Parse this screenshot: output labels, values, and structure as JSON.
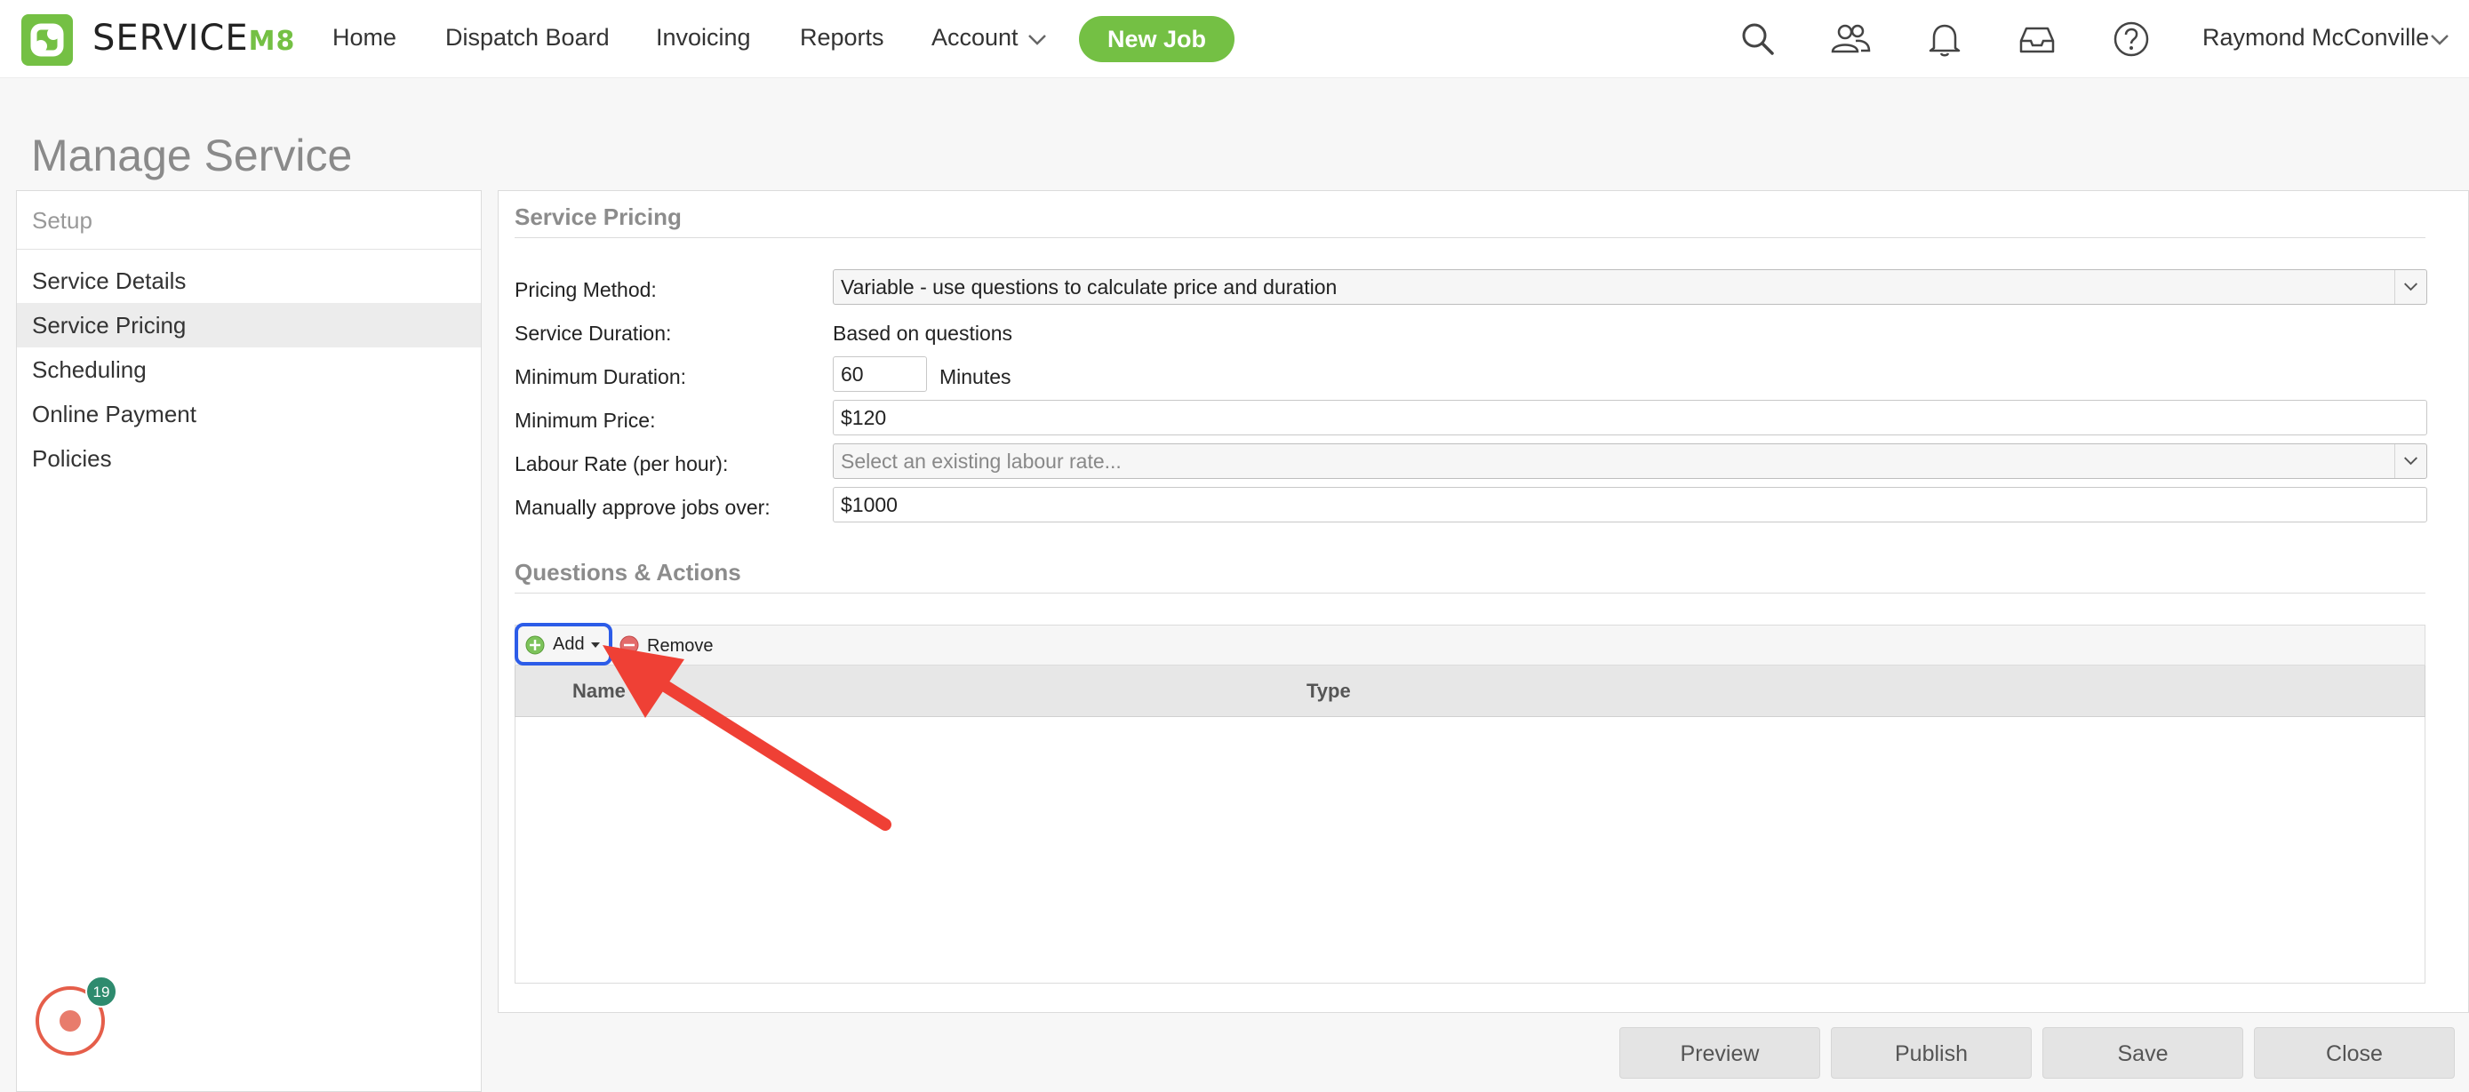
{
  "brand": {
    "name": "SERVICE",
    "suffix": "M8",
    "accent": "#74c044"
  },
  "nav": {
    "home": "Home",
    "dispatch": "Dispatch Board",
    "invoicing": "Invoicing",
    "reports": "Reports",
    "account": "Account",
    "new_job": "New Job",
    "user": "Raymond McConville"
  },
  "page": {
    "title": "Manage Service"
  },
  "sidebar": {
    "heading": "Setup",
    "items": [
      {
        "label": "Service Details"
      },
      {
        "label": "Service Pricing",
        "active": true
      },
      {
        "label": "Scheduling"
      },
      {
        "label": "Online Payment"
      },
      {
        "label": "Policies"
      }
    ]
  },
  "pricing": {
    "section_title": "Service Pricing",
    "pricing_method_label": "Pricing Method:",
    "pricing_method_value": "Variable - use questions to calculate price and duration",
    "duration_label": "Service Duration:",
    "duration_value": "Based on questions",
    "min_duration_label": "Minimum Duration:",
    "min_duration_value": "60",
    "min_duration_unit": "Minutes",
    "min_price_label": "Minimum Price:",
    "min_price_value": "$120",
    "labour_rate_label": "Labour Rate (per hour):",
    "labour_rate_placeholder": "Select an existing labour rate...",
    "approve_label": "Manually approve jobs over:",
    "approve_value": "$1000"
  },
  "questions": {
    "section_title": "Questions & Actions",
    "add_label": "Add",
    "remove_label": "Remove",
    "columns": [
      "Name",
      "Type"
    ]
  },
  "footer": {
    "preview": "Preview",
    "publish": "Publish",
    "save": "Save",
    "close": "Close"
  },
  "chat": {
    "badge_count": "19"
  },
  "icons": {
    "search": "search-icon",
    "people": "people-icon",
    "bell": "bell-icon",
    "inbox": "inbox-icon",
    "help": "help-icon"
  }
}
